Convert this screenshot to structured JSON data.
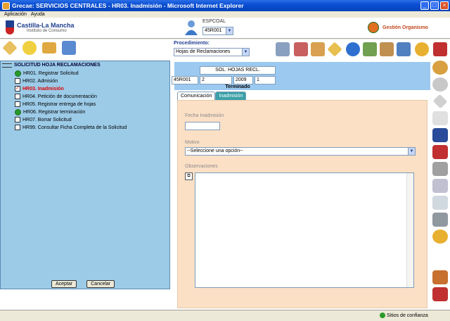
{
  "window": {
    "title": "Grecae: SERVICIOS CENTRALES - HR03. Inadmisión - Microsoft Internet Explorer"
  },
  "menu": [
    "Aplicación",
    "Ayuda"
  ],
  "header": {
    "org_name": "Castilla-La Mancha",
    "org_sub": "Instituto de Consumo",
    "user_label": "ESPCOAL",
    "user_select": "45R001",
    "gestion_label": "Gestión Organismo"
  },
  "procedure": {
    "label": "Procedimiento:",
    "value": "Hojas de Reclamaciones"
  },
  "record": {
    "type": "SOL. HOJAS RECL.",
    "fields": [
      "45R001",
      "2",
      "2009",
      "1"
    ],
    "status": "Terminado"
  },
  "tabs": [
    {
      "label": "Comunicación"
    },
    {
      "label": "Inadmisión"
    }
  ],
  "form": {
    "fecha_label": "Fecha Inadmisión",
    "fecha_value": "",
    "motivo_label": "Motivo",
    "motivo_value": "--Seleccione una opción--",
    "obs_label": "Observaciones"
  },
  "tree": {
    "root": "SOLICITUD HOJA RECLAMACIONES",
    "items": [
      {
        "label": "HR01. Registrar Solicitud"
      },
      {
        "label": "HR02. Admisión"
      },
      {
        "label": "HR03. Inadmisión"
      },
      {
        "label": "HR04. Petición de documentación"
      },
      {
        "label": "HR05. Registrar entrega de hojas"
      },
      {
        "label": "HR06. Registrar terminación"
      },
      {
        "label": "HR07. Borrar Solicitud"
      },
      {
        "label": "HR99. Consultar Ficha Completa de la Solicitud"
      }
    ],
    "accept": "Aceptar",
    "cancel": "Cancelar"
  },
  "status": {
    "zone": "Sitios de confianza"
  },
  "colors": {
    "title_bar": "#0a4fd4",
    "tree_bg": "#9ccbe8",
    "panel_bg": "#fbe0c6",
    "tab_active": "#3aa0a8",
    "accent_red": "#e00000"
  }
}
